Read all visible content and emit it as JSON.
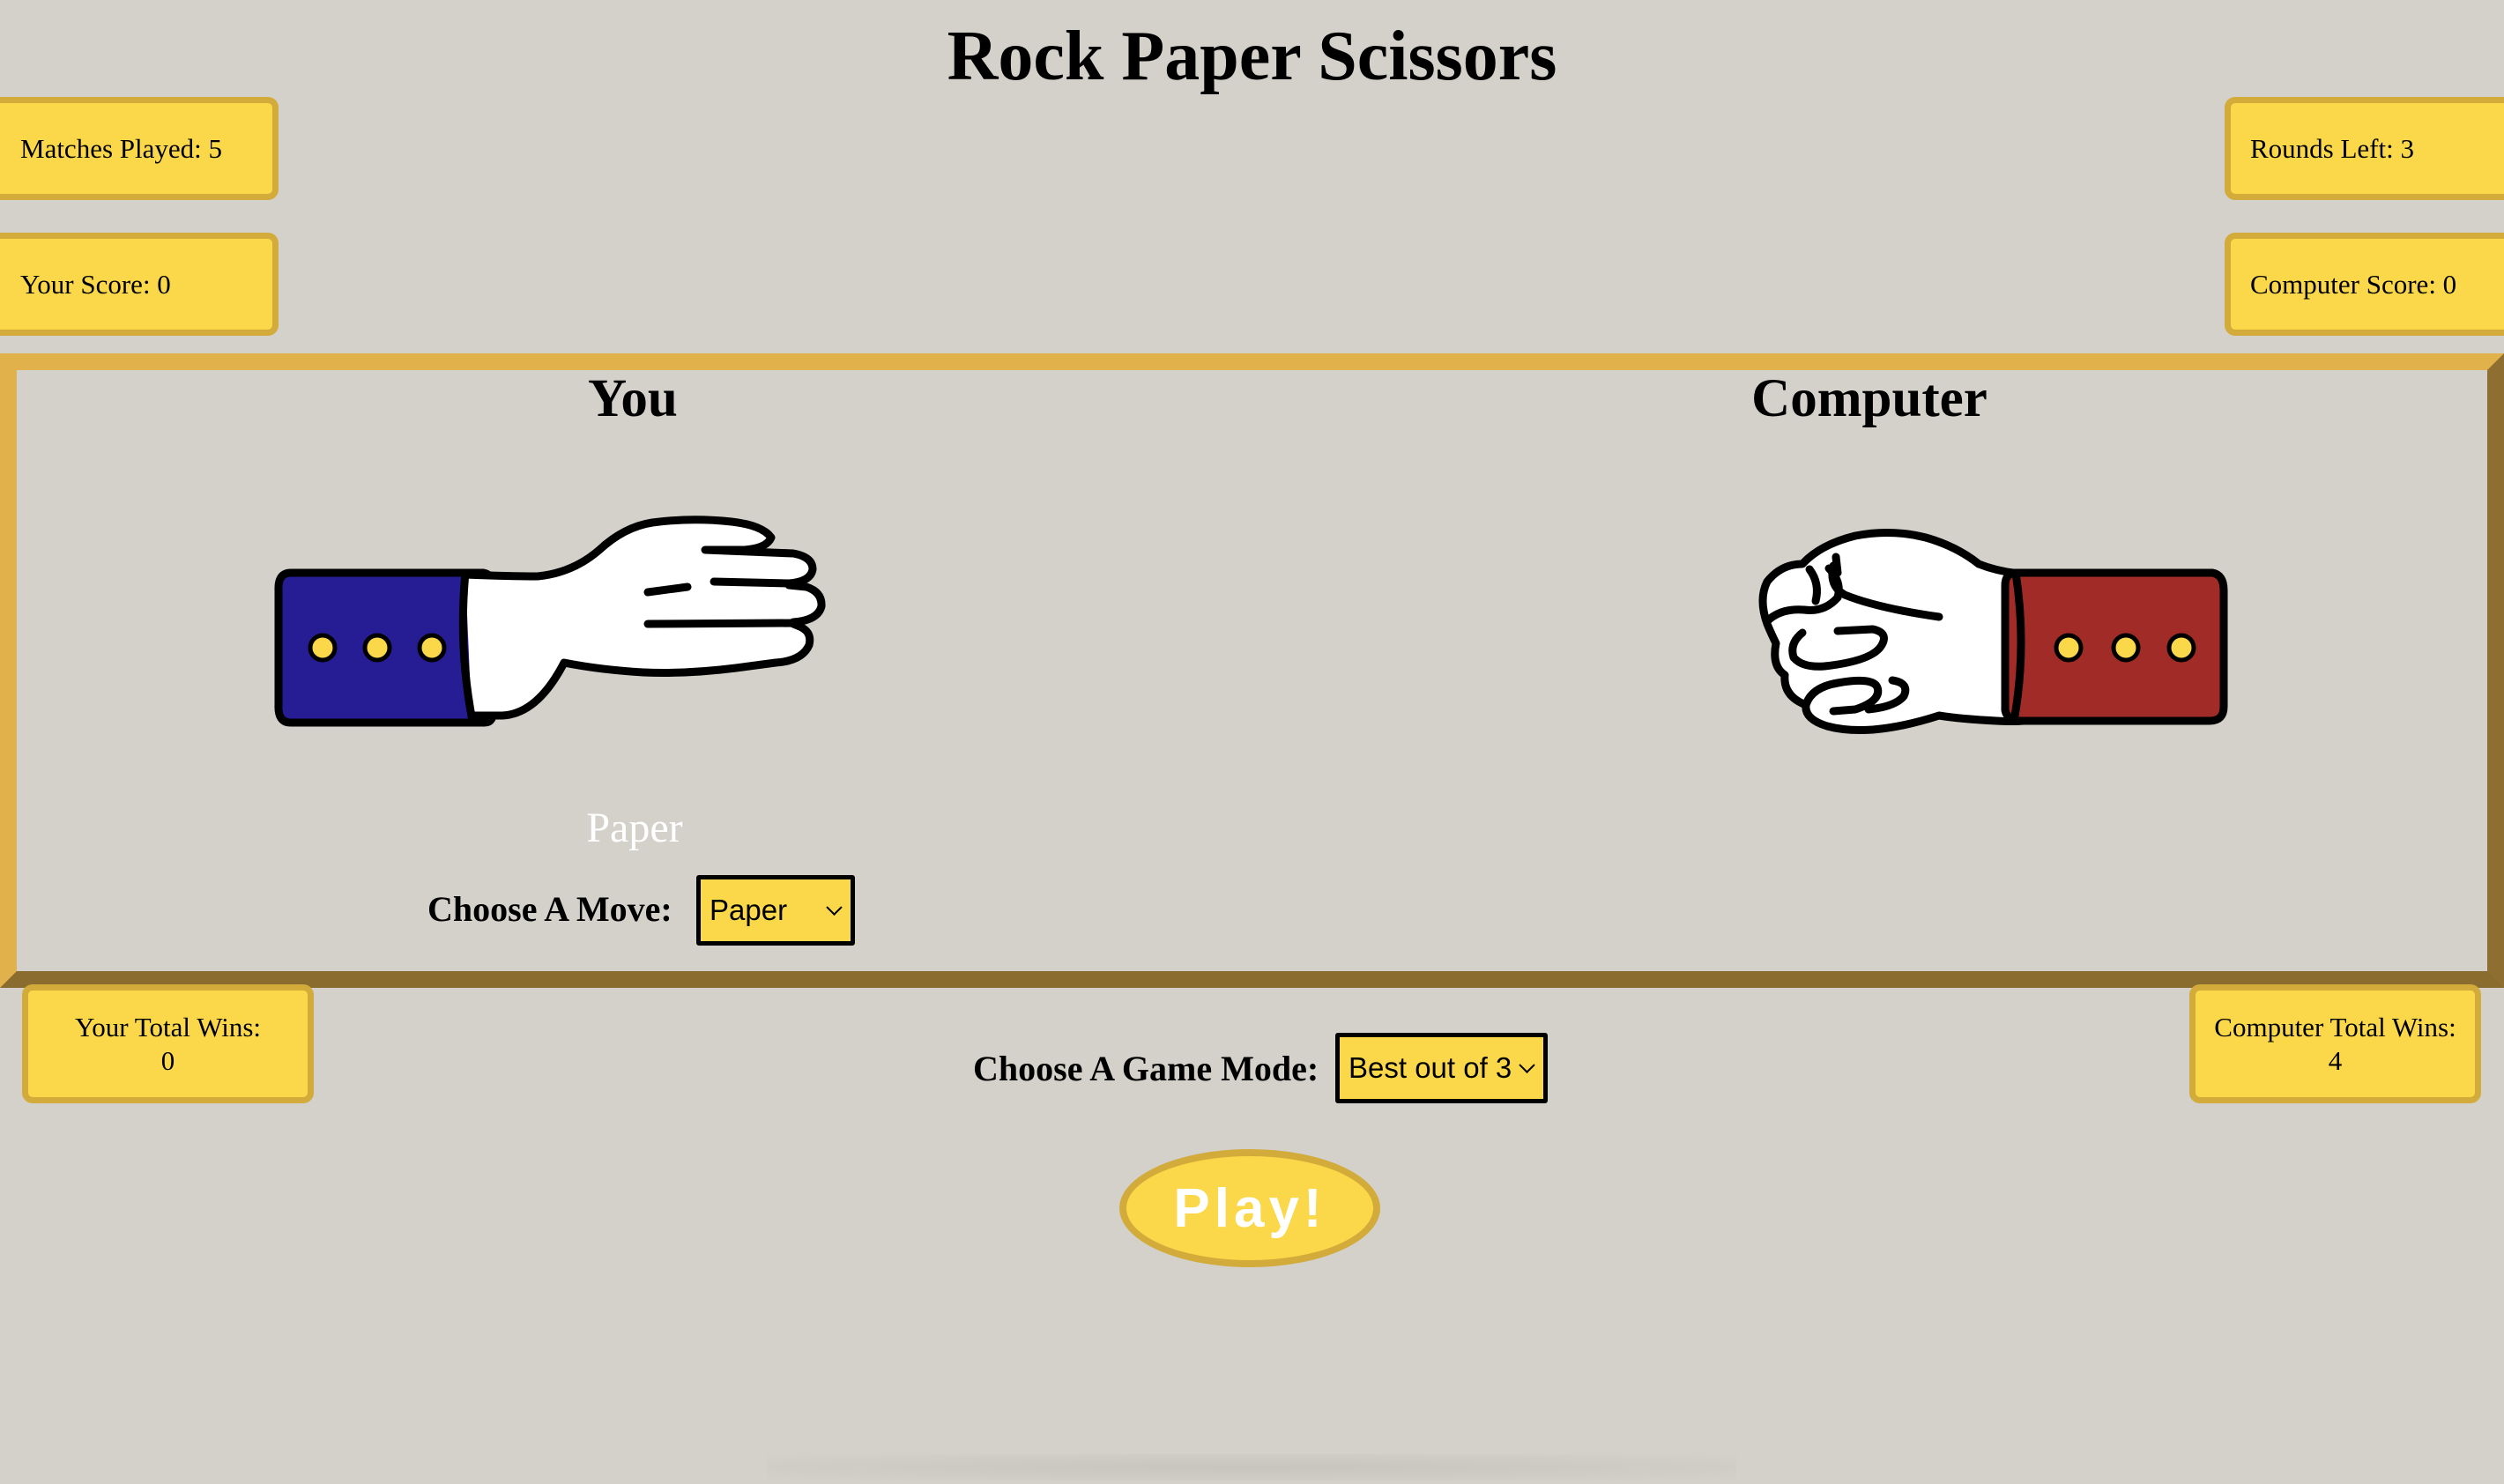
{
  "title": "Rock Paper Scissors",
  "stats": {
    "matches_played": "Matches Played: 5",
    "rounds_left": "Rounds Left: 3",
    "your_score": "Your Score: 0",
    "computer_score": "Computer Score: 0",
    "your_total_wins_label": "Your Total Wins:",
    "your_total_wins_value": "0",
    "computer_total_wins_label": "Computer Total Wins:",
    "computer_total_wins_value": "4"
  },
  "players": {
    "you": "You",
    "computer": "Computer"
  },
  "hands": {
    "you": {
      "gesture": "paper",
      "sleeve_color": "#261c93"
    },
    "computer": {
      "gesture": "rock",
      "sleeve_color": "#a02b27"
    }
  },
  "move": {
    "current": "Paper",
    "label": "Choose A Move:",
    "selected": "Paper"
  },
  "game_mode": {
    "label": "Choose A Game Mode:",
    "selected": "Best out of 3"
  },
  "play_button": "Play!",
  "colors": {
    "background": "#d3d1c9",
    "panel": "#fad84a",
    "panel_border": "#d2ab3a",
    "arena_border": "#e1b24c"
  }
}
